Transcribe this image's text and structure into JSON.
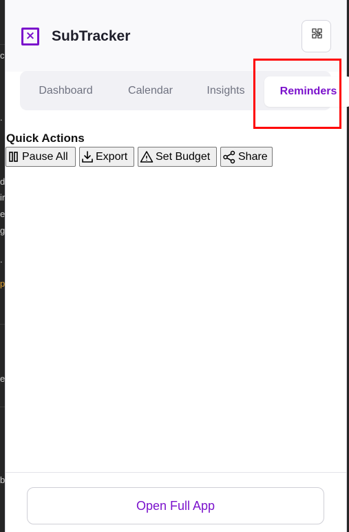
{
  "app": {
    "title": "SubTracker",
    "logo_glyph": "×",
    "accent_color": "#7b12cc"
  },
  "header": {
    "settings_icon": "puzzle-gear-icon"
  },
  "tabs": [
    {
      "label": "Dashboard",
      "active": false
    },
    {
      "label": "Calendar",
      "active": false
    },
    {
      "label": "Insights",
      "active": false
    },
    {
      "label": "Reminders",
      "active": true
    }
  ],
  "quick_actions": {
    "title": "Quick Actions",
    "buttons": [
      {
        "label": "Pause All",
        "icon": "pause-icon"
      },
      {
        "label": "Export",
        "icon": "download-icon"
      },
      {
        "label": "Set Budget",
        "icon": "warning-icon"
      },
      {
        "label": "Share",
        "icon": "share-icon"
      }
    ]
  },
  "footer": {
    "open_full_app_label": "Open Full App"
  },
  "background_fragments": [
    "c",
    ".",
    "d",
    "ir",
    "e",
    "g",
    ".",
    "p",
    "e",
    "b"
  ]
}
